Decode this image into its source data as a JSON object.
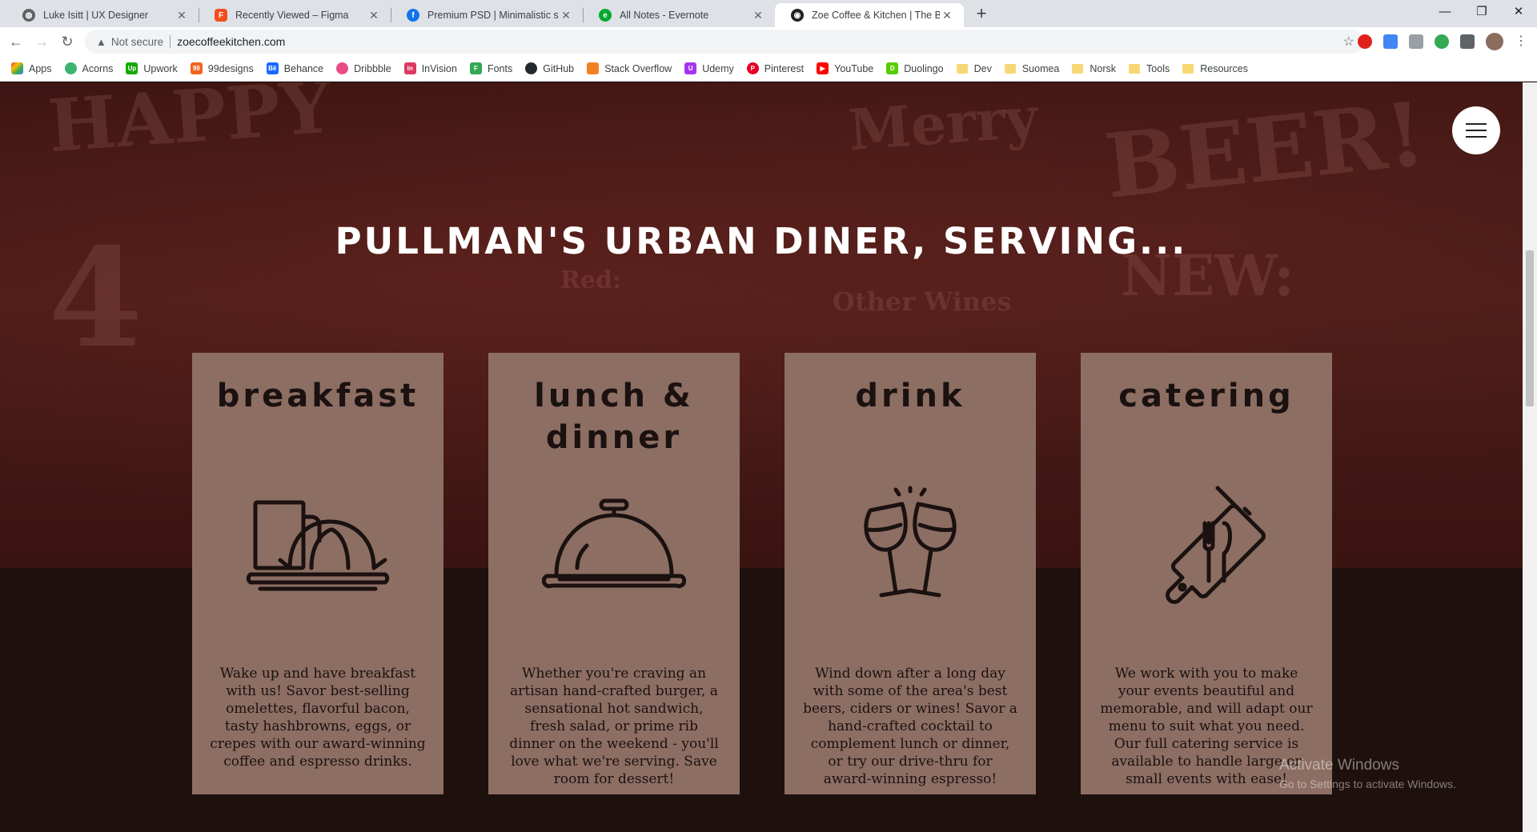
{
  "browser": {
    "tabs": [
      {
        "title": "Luke Isitt | UX Designer",
        "icon": "globe-icon",
        "color": "#5f6368",
        "active": false
      },
      {
        "title": "Recently Viewed – Figma",
        "icon": "figma-icon",
        "color": "#f24e1e",
        "active": false
      },
      {
        "title": "Premium PSD | Minimalistic scene",
        "icon": "freepik-icon",
        "color": "#1273eb",
        "active": false
      },
      {
        "title": "All Notes - Evernote",
        "icon": "evernote-icon",
        "color": "#00a82d",
        "active": false
      },
      {
        "title": "Zoe Coffee & Kitchen | The Best P",
        "icon": "site-icon",
        "color": "#202124",
        "active": true
      }
    ],
    "new_tab": "+",
    "address": {
      "warning": "Not secure",
      "url": "zoecoffeekitchen.com"
    },
    "bookmarks": [
      {
        "label": "Apps",
        "icon": "apps-grid-icon",
        "color": "#ea4335"
      },
      {
        "label": "Acorns",
        "icon": "acorns-icon",
        "color": "#3cb371"
      },
      {
        "label": "Upwork",
        "icon": "upwork-icon",
        "color": "#14a800"
      },
      {
        "label": "99designs",
        "icon": "99designs-icon",
        "color": "#f26322"
      },
      {
        "label": "Behance",
        "icon": "behance-icon",
        "color": "#1769ff"
      },
      {
        "label": "Dribbble",
        "icon": "dribbble-icon",
        "color": "#ea4c89"
      },
      {
        "label": "InVision",
        "icon": "invision-icon",
        "color": "#dc395f"
      },
      {
        "label": "Fonts",
        "icon": "fonts-icon",
        "color": "#34a853"
      },
      {
        "label": "GitHub",
        "icon": "github-icon",
        "color": "#24292e"
      },
      {
        "label": "Stack Overflow",
        "icon": "stackoverflow-icon",
        "color": "#f48024"
      },
      {
        "label": "Udemy",
        "icon": "udemy-icon",
        "color": "#a435f0"
      },
      {
        "label": "Pinterest",
        "icon": "pinterest-icon",
        "color": "#e60023"
      },
      {
        "label": "YouTube",
        "icon": "youtube-icon",
        "color": "#ff0000"
      },
      {
        "label": "Duolingo",
        "icon": "duolingo-icon",
        "color": "#58cc02"
      },
      {
        "label": "Dev",
        "icon": "folder-icon",
        "color": "#f7d774"
      },
      {
        "label": "Suomea",
        "icon": "folder-icon",
        "color": "#f7d774"
      },
      {
        "label": "Norsk",
        "icon": "folder-icon",
        "color": "#f7d774"
      },
      {
        "label": "Tools",
        "icon": "folder-icon",
        "color": "#f7d774"
      },
      {
        "label": "Resources",
        "icon": "folder-icon",
        "color": "#f7d774"
      }
    ]
  },
  "page": {
    "headline": "PULLMAN'S URBAN DINER, SERVING...",
    "colors": {
      "card": "#8d6e63",
      "hero": "#4a1c18",
      "lower": "#1e100d"
    },
    "cards": [
      {
        "title": "breakfast",
        "icon": "coffee-croissant-icon",
        "text": "Wake up and have breakfast with us! Savor best-selling omelettes, flavorful bacon, tasty hashbrowns, eggs, or crepes with our award-winning coffee and espresso drinks."
      },
      {
        "title": "lunch & dinner",
        "icon": "cloche-icon",
        "text": "Whether you're craving an artisan hand-crafted burger, a sensational hot sandwich, fresh salad, or prime rib dinner on the weekend - you'll love what we're serving. Save room for dessert!"
      },
      {
        "title": "drink",
        "icon": "wine-toast-icon",
        "text": "Wind down after a long day with some of the area's best beers, ciders or wines! Savor a hand-crafted cocktail to complement lunch or dinner, or try our drive-thru for award-winning espresso!"
      },
      {
        "title": "catering",
        "icon": "cutting-board-icon",
        "text": "We work with you to make your events beautiful and memorable, and will adapt our menu to suit what you need. Our full catering service is available to handle large or small events with ease!"
      }
    ],
    "watermark": {
      "line1": "Activate Windows",
      "line2": "Go to Settings to activate Windows."
    }
  }
}
